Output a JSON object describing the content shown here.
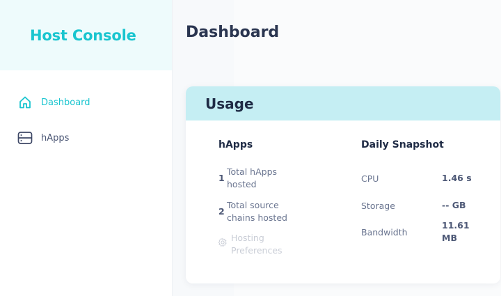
{
  "sidebar": {
    "title": "Host Console",
    "items": [
      {
        "label": "Dashboard",
        "icon": "home-icon",
        "active": true
      },
      {
        "label": "hApps",
        "icon": "server-icon",
        "active": false
      }
    ]
  },
  "main": {
    "page_title": "Dashboard",
    "usage_card": {
      "title": "Usage",
      "happs": {
        "heading": "hApps",
        "stats": [
          {
            "count": "1",
            "label": "Total hApps hosted"
          },
          {
            "count": "2",
            "label": "Total source chains hosted"
          }
        ],
        "preferences_label": "Hosting Preferences"
      },
      "snapshot": {
        "heading": "Daily Snapshot",
        "rows": [
          {
            "metric": "CPU",
            "value": "1.46 s"
          },
          {
            "metric": "Storage",
            "value": "-- GB"
          },
          {
            "metric": "Bandwidth",
            "value": "11.61 MB"
          }
        ]
      }
    }
  },
  "colors": {
    "accent": "#19c5cf",
    "header_bg": "#eefbfc",
    "card_header_bg": "#c5eef3",
    "text_dark": "#1f2b45"
  }
}
